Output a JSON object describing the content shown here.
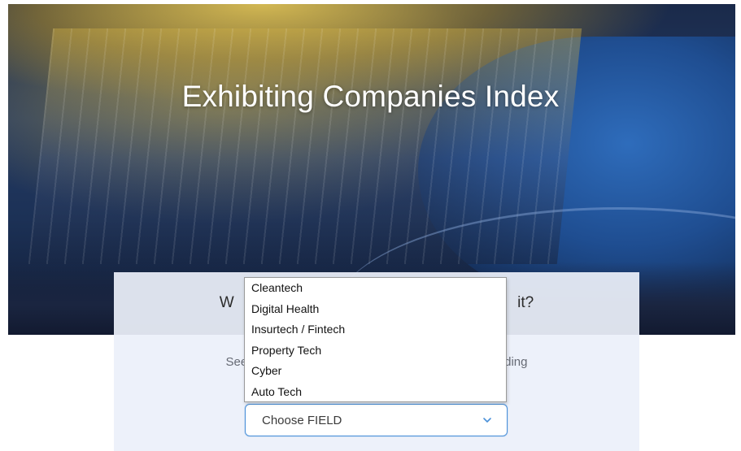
{
  "hero": {
    "title": "Exhibiting Companies Index"
  },
  "card": {
    "heading": "W                                                                  it?",
    "subtext": "See w                                                                     ording"
  },
  "select": {
    "value": "Choose FIELD",
    "chevron_icon": "chevron-down-icon",
    "accent_color": "#4a90d9"
  },
  "dropdown": {
    "options": [
      "Cleantech",
      "Digital Health",
      "Insurtech / Fintech",
      "Property Tech",
      "Cyber",
      "Auto Tech"
    ]
  }
}
